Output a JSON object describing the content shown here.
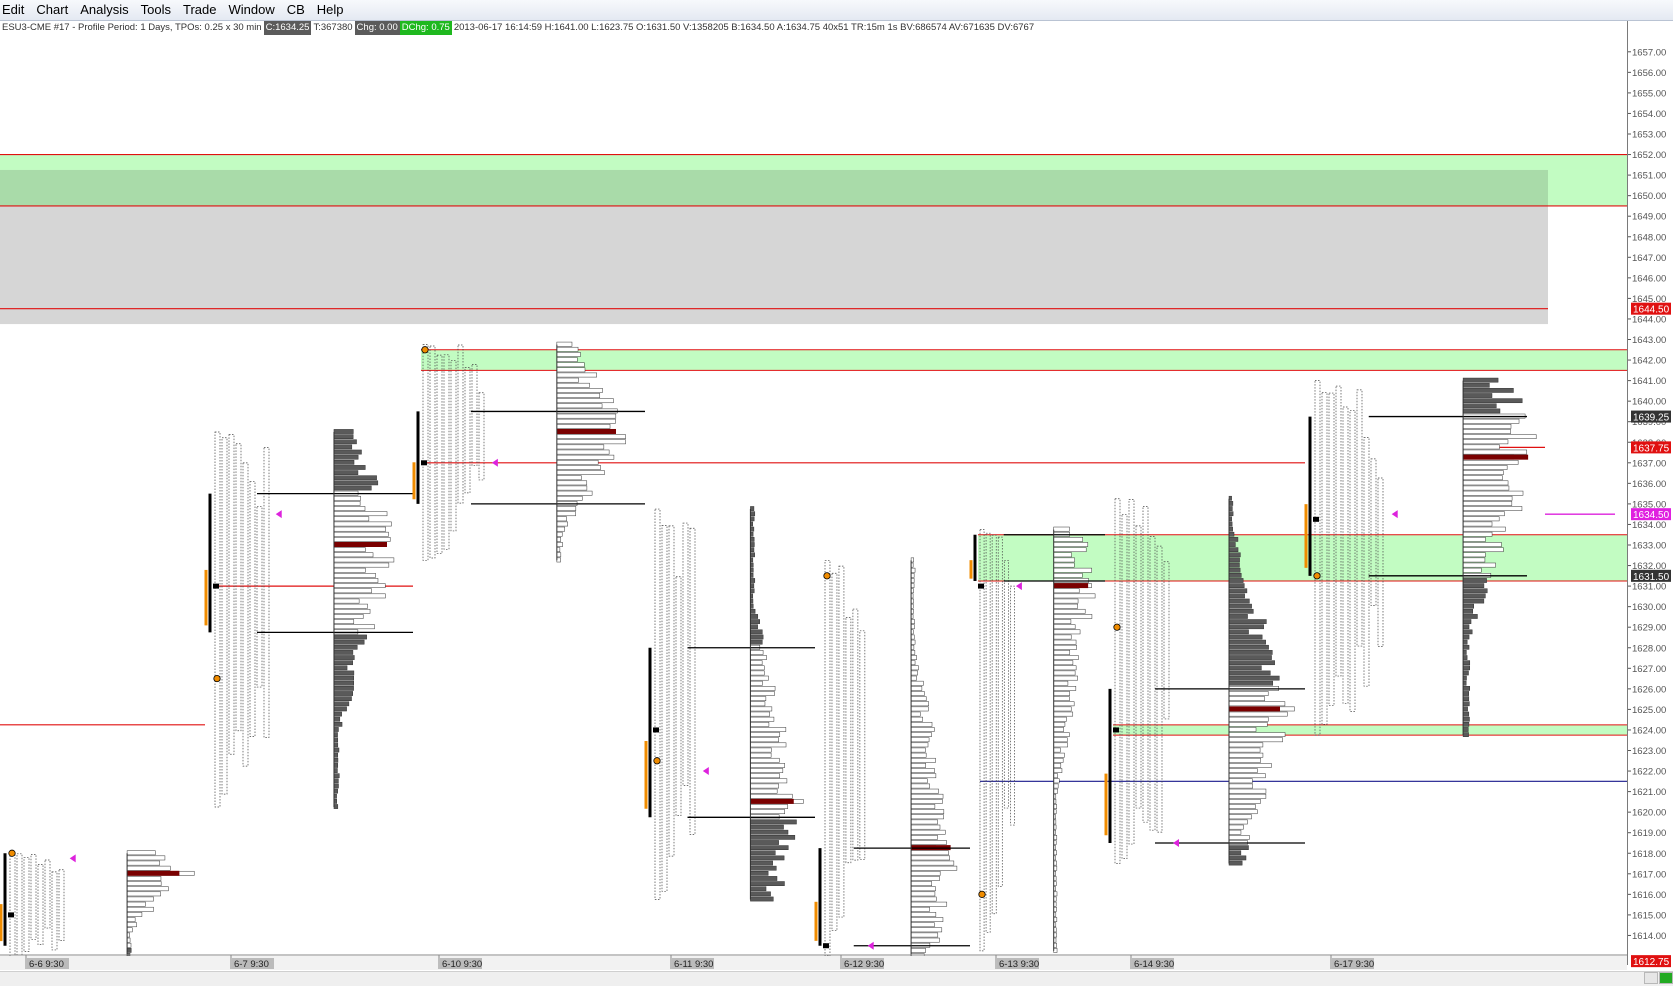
{
  "menu": [
    "Edit",
    "Chart",
    "Analysis",
    "Tools",
    "Trade",
    "Window",
    "CB",
    "Help"
  ],
  "infobar": {
    "symbol_info": "ESU3-CME  #17 - Profile Period: 1 Days, TPOs: 0.25 x 30 min",
    "close": "C:1634.25",
    "ticks": "T:367380",
    "chg": "Chg: 0.00",
    "dchg": "DChg: 0.75",
    "rest": "2013-06-17 16:14:59 H:1641.00 L:1623.75 O:1631.50 V:1358205 B:1634.50 A:1634.75 40x51 TR:15m 1s BV:686574 AV:671635 DV:6767"
  },
  "colors": {
    "zone_green": "#c2fcc2",
    "zone_gray": "#d6d6d6",
    "zone_overlap": "#a9dba9",
    "level_red": "#e01010",
    "poc_maroon": "#7a0000",
    "value_area_orange": "#f08c00",
    "tpo_dark": "#5a5a5a",
    "marker_magenta": "#dd22dd",
    "line_navy": "#1a1a8c",
    "label_red_bg": "#e01010",
    "label_dark_bg": "#333333",
    "label_magenta_bg": "#e020e0"
  },
  "chart_data": {
    "type": "market-profile",
    "ylim": [
      1613.0,
      1657.5
    ],
    "y_ticks": [
      1614,
      1615,
      1616,
      1617,
      1618,
      1619,
      1620,
      1621,
      1622,
      1623,
      1624,
      1625,
      1626,
      1627,
      1628,
      1629,
      1630,
      1631,
      1632,
      1633,
      1634,
      1635,
      1636,
      1637,
      1638,
      1639,
      1640,
      1641,
      1642,
      1643,
      1644,
      1645,
      1646,
      1647,
      1648,
      1649,
      1650,
      1651,
      1652,
      1653,
      1654,
      1655,
      1656,
      1657
    ],
    "x_labels": [
      "6-6 9:30",
      "6-7 9:30",
      "6-10 9:30",
      "6-11 9:30",
      "6-12 9:30",
      "6-13 9:30",
      "6-14 9:30",
      "6-17 9:30"
    ],
    "price_labels": [
      {
        "price": 1644.5,
        "text": "1644.50",
        "style": "red"
      },
      {
        "price": 1639.25,
        "text": "1639.25",
        "style": "dark"
      },
      {
        "price": 1637.75,
        "text": "1637.75",
        "style": "red"
      },
      {
        "price": 1634.5,
        "text": "1634.50",
        "style": "magenta"
      },
      {
        "price": 1631.5,
        "text": "1631.50",
        "style": "dark"
      },
      {
        "price": 1612.75,
        "text": "1612.75",
        "style": "red"
      }
    ],
    "zones": [
      {
        "type": "green",
        "low": 1649.5,
        "high": 1652.0,
        "extends": "right"
      },
      {
        "type": "gray",
        "low": 1643.75,
        "high": 1651.25,
        "extends": "left"
      },
      {
        "type": "green",
        "low": 1641.5,
        "high": 1642.5,
        "start_session": 2
      },
      {
        "type": "green",
        "low": 1631.25,
        "high": 1633.5,
        "start_session": 5
      },
      {
        "type": "green",
        "low": 1623.75,
        "high": 1624.25,
        "start_session": 6
      }
    ],
    "levels": [
      {
        "price": 1644.5,
        "color": "red",
        "from": "left",
        "to": "gray-zone-end"
      },
      {
        "price": 1652.0,
        "color": "red",
        "from": "left",
        "to": "right"
      },
      {
        "price": 1649.5,
        "color": "red",
        "from": "left",
        "to": "right"
      },
      {
        "price": 1637.0,
        "color": "red",
        "from_session": 2,
        "to_session": 7
      },
      {
        "price": 1631.0,
        "color": "red",
        "from_session": 1,
        "to_session": 2
      },
      {
        "price": 1624.25,
        "color": "red",
        "from": "left",
        "to_session": 1
      },
      {
        "price": 1621.5,
        "color": "navy",
        "from_session": 5,
        "to": "right"
      },
      {
        "price": 1637.75,
        "color": "red",
        "from_session": 7,
        "to": "session-end"
      }
    ],
    "sessions": [
      {
        "label": "6-6 9:30",
        "high": 1618.0,
        "low": 1612.75,
        "poc": 1617.0,
        "vah": 1618.0,
        "val": 1613.5,
        "open": 1618.0,
        "close": 1615.0,
        "poc_marker": 1617.75,
        "tpo_base": 1613
      },
      {
        "label": "6-7 9:30",
        "high": 1638.5,
        "low": 1620.25,
        "poc": 1633.0,
        "vah": 1635.5,
        "val": 1628.75,
        "open": 1626.5,
        "close": 1631.0,
        "poc_marker": 1634.5,
        "tpo_base": 1620
      },
      {
        "label": "6-10 9:30",
        "high": 1642.75,
        "low": 1632.25,
        "poc": 1638.5,
        "vah": 1639.5,
        "val": 1635.0,
        "open": 1642.5,
        "close": 1637.0,
        "poc_marker": 1637.0,
        "tpo_base": 1632
      },
      {
        "label": "6-11 9:30",
        "high": 1634.75,
        "low": 1615.75,
        "poc": 1620.5,
        "vah": 1628.0,
        "val": 1619.75,
        "open": 1622.5,
        "close": 1624.0,
        "poc_marker": 1622.0,
        "tpo_base": 1616
      },
      {
        "label": "6-12 9:30",
        "high": 1632.25,
        "low": 1613.0,
        "poc": 1618.25,
        "vah": 1618.25,
        "val": 1613.5,
        "open": 1631.5,
        "close": 1613.5,
        "poc_marker": 1613.5,
        "tpo_base": 1613
      },
      {
        "label": "6-13 9:30",
        "high": 1633.75,
        "low": 1613.25,
        "poc": 1631.0,
        "vah": 1633.5,
        "val": 1631.25,
        "open": 1616.0,
        "close": 1631.0,
        "poc_marker": 1631.0,
        "tpo_base": 1613
      },
      {
        "label": "6-14 9:30",
        "high": 1635.25,
        "low": 1617.5,
        "poc": 1625.0,
        "vah": 1626.0,
        "val": 1618.5,
        "open": 1629.0,
        "close": 1624.0,
        "poc_marker": 1618.5,
        "tpo_base": 1617
      },
      {
        "label": "6-17 9:30",
        "high": 1641.0,
        "low": 1623.75,
        "poc": 1637.25,
        "vah": 1639.25,
        "val": 1631.5,
        "open": 1631.5,
        "close": 1634.25,
        "poc_marker": 1634.5,
        "tpo_base": 1624
      }
    ]
  }
}
